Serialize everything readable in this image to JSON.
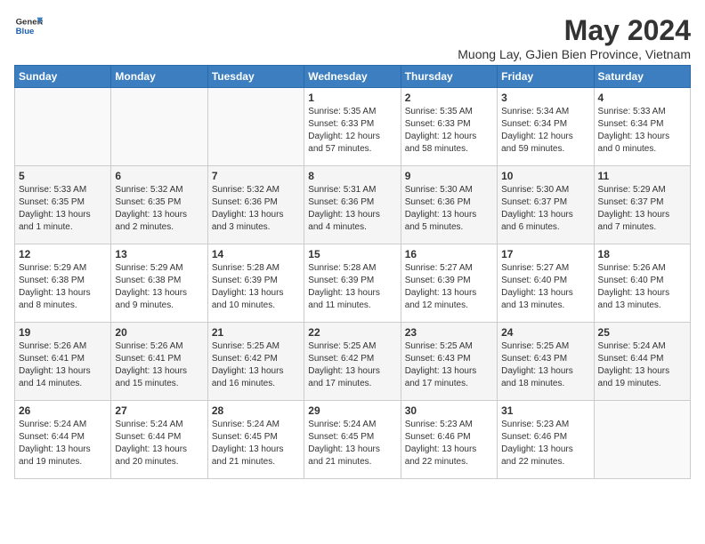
{
  "header": {
    "logo_line1": "General",
    "logo_line2": "Blue",
    "month_year": "May 2024",
    "location": "Muong Lay, GJien Bien Province, Vietnam"
  },
  "weekdays": [
    "Sunday",
    "Monday",
    "Tuesday",
    "Wednesday",
    "Thursday",
    "Friday",
    "Saturday"
  ],
  "weeks": [
    [
      {
        "day": "",
        "sunrise": "",
        "sunset": "",
        "daylight": ""
      },
      {
        "day": "",
        "sunrise": "",
        "sunset": "",
        "daylight": ""
      },
      {
        "day": "",
        "sunrise": "",
        "sunset": "",
        "daylight": ""
      },
      {
        "day": "1",
        "sunrise": "Sunrise: 5:35 AM",
        "sunset": "Sunset: 6:33 PM",
        "daylight": "Daylight: 12 hours and 57 minutes."
      },
      {
        "day": "2",
        "sunrise": "Sunrise: 5:35 AM",
        "sunset": "Sunset: 6:33 PM",
        "daylight": "Daylight: 12 hours and 58 minutes."
      },
      {
        "day": "3",
        "sunrise": "Sunrise: 5:34 AM",
        "sunset": "Sunset: 6:34 PM",
        "daylight": "Daylight: 12 hours and 59 minutes."
      },
      {
        "day": "4",
        "sunrise": "Sunrise: 5:33 AM",
        "sunset": "Sunset: 6:34 PM",
        "daylight": "Daylight: 13 hours and 0 minutes."
      }
    ],
    [
      {
        "day": "5",
        "sunrise": "Sunrise: 5:33 AM",
        "sunset": "Sunset: 6:35 PM",
        "daylight": "Daylight: 13 hours and 1 minute."
      },
      {
        "day": "6",
        "sunrise": "Sunrise: 5:32 AM",
        "sunset": "Sunset: 6:35 PM",
        "daylight": "Daylight: 13 hours and 2 minutes."
      },
      {
        "day": "7",
        "sunrise": "Sunrise: 5:32 AM",
        "sunset": "Sunset: 6:36 PM",
        "daylight": "Daylight: 13 hours and 3 minutes."
      },
      {
        "day": "8",
        "sunrise": "Sunrise: 5:31 AM",
        "sunset": "Sunset: 6:36 PM",
        "daylight": "Daylight: 13 hours and 4 minutes."
      },
      {
        "day": "9",
        "sunrise": "Sunrise: 5:30 AM",
        "sunset": "Sunset: 6:36 PM",
        "daylight": "Daylight: 13 hours and 5 minutes."
      },
      {
        "day": "10",
        "sunrise": "Sunrise: 5:30 AM",
        "sunset": "Sunset: 6:37 PM",
        "daylight": "Daylight: 13 hours and 6 minutes."
      },
      {
        "day": "11",
        "sunrise": "Sunrise: 5:29 AM",
        "sunset": "Sunset: 6:37 PM",
        "daylight": "Daylight: 13 hours and 7 minutes."
      }
    ],
    [
      {
        "day": "12",
        "sunrise": "Sunrise: 5:29 AM",
        "sunset": "Sunset: 6:38 PM",
        "daylight": "Daylight: 13 hours and 8 minutes."
      },
      {
        "day": "13",
        "sunrise": "Sunrise: 5:29 AM",
        "sunset": "Sunset: 6:38 PM",
        "daylight": "Daylight: 13 hours and 9 minutes."
      },
      {
        "day": "14",
        "sunrise": "Sunrise: 5:28 AM",
        "sunset": "Sunset: 6:39 PM",
        "daylight": "Daylight: 13 hours and 10 minutes."
      },
      {
        "day": "15",
        "sunrise": "Sunrise: 5:28 AM",
        "sunset": "Sunset: 6:39 PM",
        "daylight": "Daylight: 13 hours and 11 minutes."
      },
      {
        "day": "16",
        "sunrise": "Sunrise: 5:27 AM",
        "sunset": "Sunset: 6:39 PM",
        "daylight": "Daylight: 13 hours and 12 minutes."
      },
      {
        "day": "17",
        "sunrise": "Sunrise: 5:27 AM",
        "sunset": "Sunset: 6:40 PM",
        "daylight": "Daylight: 13 hours and 13 minutes."
      },
      {
        "day": "18",
        "sunrise": "Sunrise: 5:26 AM",
        "sunset": "Sunset: 6:40 PM",
        "daylight": "Daylight: 13 hours and 13 minutes."
      }
    ],
    [
      {
        "day": "19",
        "sunrise": "Sunrise: 5:26 AM",
        "sunset": "Sunset: 6:41 PM",
        "daylight": "Daylight: 13 hours and 14 minutes."
      },
      {
        "day": "20",
        "sunrise": "Sunrise: 5:26 AM",
        "sunset": "Sunset: 6:41 PM",
        "daylight": "Daylight: 13 hours and 15 minutes."
      },
      {
        "day": "21",
        "sunrise": "Sunrise: 5:25 AM",
        "sunset": "Sunset: 6:42 PM",
        "daylight": "Daylight: 13 hours and 16 minutes."
      },
      {
        "day": "22",
        "sunrise": "Sunrise: 5:25 AM",
        "sunset": "Sunset: 6:42 PM",
        "daylight": "Daylight: 13 hours and 17 minutes."
      },
      {
        "day": "23",
        "sunrise": "Sunrise: 5:25 AM",
        "sunset": "Sunset: 6:43 PM",
        "daylight": "Daylight: 13 hours and 17 minutes."
      },
      {
        "day": "24",
        "sunrise": "Sunrise: 5:25 AM",
        "sunset": "Sunset: 6:43 PM",
        "daylight": "Daylight: 13 hours and 18 minutes."
      },
      {
        "day": "25",
        "sunrise": "Sunrise: 5:24 AM",
        "sunset": "Sunset: 6:44 PM",
        "daylight": "Daylight: 13 hours and 19 minutes."
      }
    ],
    [
      {
        "day": "26",
        "sunrise": "Sunrise: 5:24 AM",
        "sunset": "Sunset: 6:44 PM",
        "daylight": "Daylight: 13 hours and 19 minutes."
      },
      {
        "day": "27",
        "sunrise": "Sunrise: 5:24 AM",
        "sunset": "Sunset: 6:44 PM",
        "daylight": "Daylight: 13 hours and 20 minutes."
      },
      {
        "day": "28",
        "sunrise": "Sunrise: 5:24 AM",
        "sunset": "Sunset: 6:45 PM",
        "daylight": "Daylight: 13 hours and 21 minutes."
      },
      {
        "day": "29",
        "sunrise": "Sunrise: 5:24 AM",
        "sunset": "Sunset: 6:45 PM",
        "daylight": "Daylight: 13 hours and 21 minutes."
      },
      {
        "day": "30",
        "sunrise": "Sunrise: 5:23 AM",
        "sunset": "Sunset: 6:46 PM",
        "daylight": "Daylight: 13 hours and 22 minutes."
      },
      {
        "day": "31",
        "sunrise": "Sunrise: 5:23 AM",
        "sunset": "Sunset: 6:46 PM",
        "daylight": "Daylight: 13 hours and 22 minutes."
      },
      {
        "day": "",
        "sunrise": "",
        "sunset": "",
        "daylight": ""
      }
    ]
  ]
}
